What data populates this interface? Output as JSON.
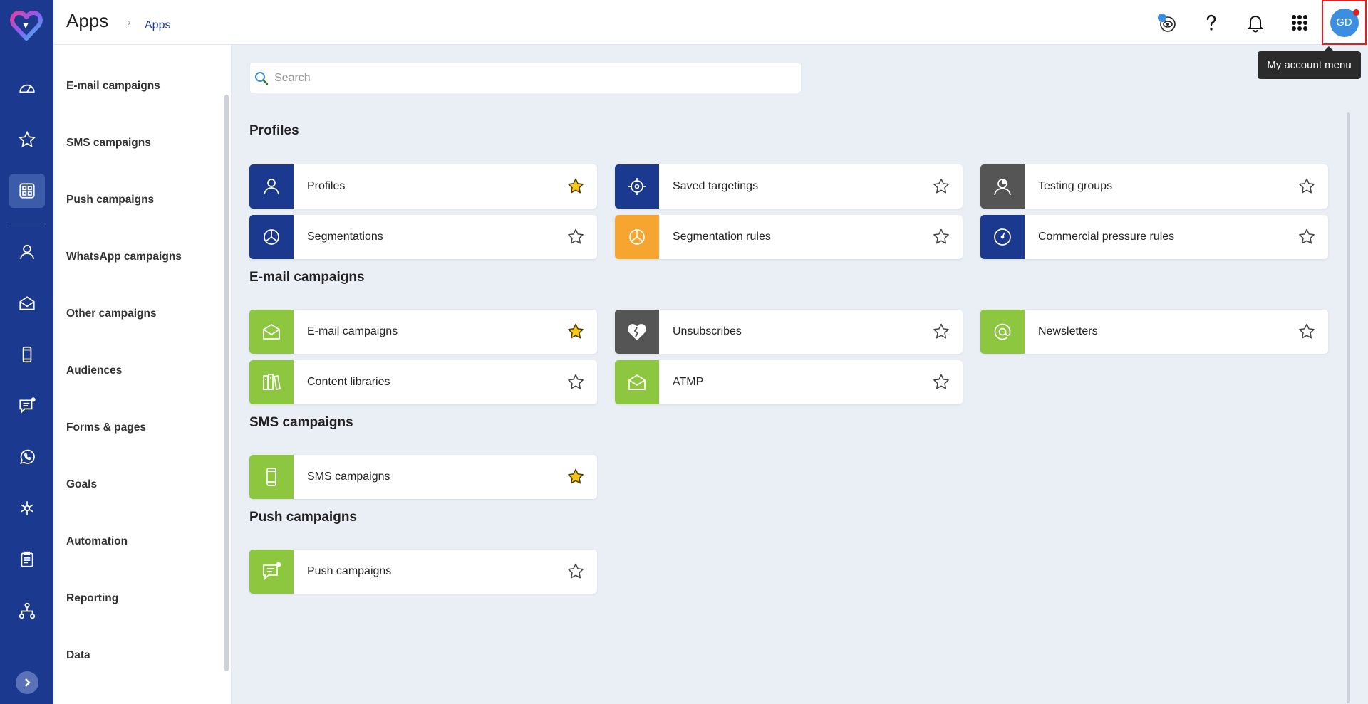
{
  "colors": {
    "navy": "#1b3a8f",
    "green": "#8dc63f",
    "orange": "#f7a531",
    "gray": "#555555",
    "star_gold": "#f5c518",
    "accent": "#3b8ee0"
  },
  "header": {
    "title": "Apps",
    "breadcrumb": "Apps",
    "avatar_initials": "GD",
    "tooltip": "My account menu"
  },
  "search": {
    "placeholder": "Search",
    "value": ""
  },
  "sidebar": {
    "items": [
      {
        "label": "E-mail campaigns"
      },
      {
        "label": "SMS campaigns"
      },
      {
        "label": "Push campaigns"
      },
      {
        "label": "WhatsApp campaigns"
      },
      {
        "label": "Other campaigns"
      },
      {
        "label": "Audiences"
      },
      {
        "label": "Forms & pages"
      },
      {
        "label": "Goals"
      },
      {
        "label": "Automation"
      },
      {
        "label": "Reporting"
      },
      {
        "label": "Data"
      }
    ]
  },
  "rail": {
    "icons": [
      "dashboard-icon",
      "star-icon",
      "apps-icon",
      "profile-icon",
      "email-icon",
      "mobile-icon",
      "push-icon",
      "whatsapp-icon",
      "network-icon",
      "clipboard-icon",
      "hierarchy-icon"
    ]
  },
  "sections": [
    {
      "title": "Profiles",
      "cards": [
        {
          "label": "Profiles",
          "icon": "person-icon",
          "color": "navy",
          "favorite": true
        },
        {
          "label": "Saved targetings",
          "icon": "target-icon",
          "color": "navy",
          "favorite": false
        },
        {
          "label": "Testing groups",
          "icon": "testing-group-icon",
          "color": "gray",
          "favorite": false
        },
        {
          "label": "Segmentations",
          "icon": "pie-icon",
          "color": "navy",
          "favorite": false
        },
        {
          "label": "Segmentation rules",
          "icon": "pie-icon",
          "color": "orange",
          "favorite": false
        },
        {
          "label": "Commercial pressure rules",
          "icon": "gauge-icon",
          "color": "navy",
          "favorite": false
        }
      ]
    },
    {
      "title": "E-mail campaigns",
      "cards": [
        {
          "label": "E-mail campaigns",
          "icon": "envelope-icon",
          "color": "green",
          "favorite": true
        },
        {
          "label": "Unsubscribes",
          "icon": "broken-heart-icon",
          "color": "gray",
          "favorite": false
        },
        {
          "label": "Newsletters",
          "icon": "at-icon",
          "color": "green",
          "favorite": false
        },
        {
          "label": "Content libraries",
          "icon": "library-icon",
          "color": "green",
          "favorite": false
        },
        {
          "label": "ATMP",
          "icon": "envelope-icon",
          "color": "green",
          "favorite": false
        }
      ]
    },
    {
      "title": "SMS campaigns",
      "cards": [
        {
          "label": "SMS campaigns",
          "icon": "mobile-icon",
          "color": "green",
          "favorite": true
        }
      ]
    },
    {
      "title": "Push campaigns",
      "cards": [
        {
          "label": "Push campaigns",
          "icon": "push-icon",
          "color": "green",
          "favorite": false
        }
      ]
    }
  ]
}
